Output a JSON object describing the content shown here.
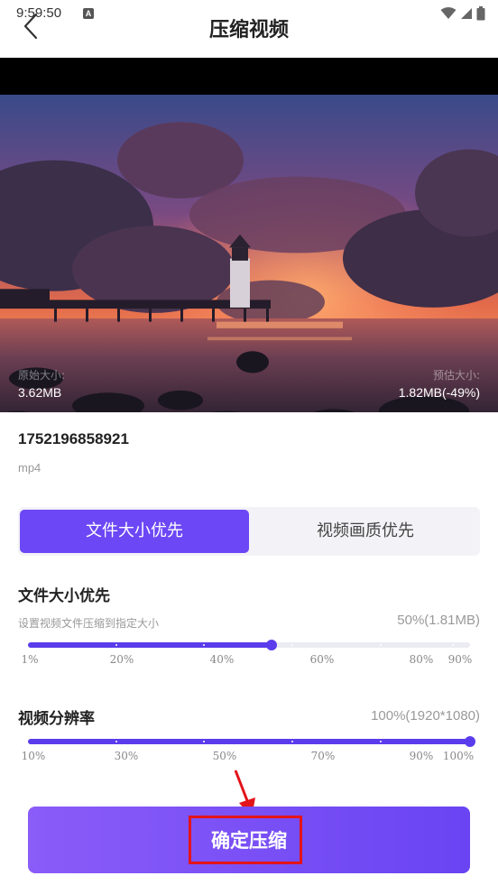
{
  "status_bar": {
    "time": "9:59:50",
    "indicator": "A",
    "icons": [
      "wifi-icon",
      "signal-icon",
      "battery-icon"
    ]
  },
  "nav": {
    "title": "压缩视频",
    "back_icon": "chevron-left-icon"
  },
  "video": {
    "original_size_label": "原始大小:",
    "original_size": "3.62MB",
    "estimated_size_label": "预估大小:",
    "estimated_size": "1.82MB(-49%)"
  },
  "file": {
    "name": "1752196858921",
    "format": "mp4"
  },
  "mode_tabs": {
    "active": "文件大小优先",
    "inactive": "视频画质优先"
  },
  "size_section": {
    "title": "文件大小优先",
    "description": "设置视频文件压缩到指定大小",
    "value": "50%(1.81MB)",
    "level": 0.55,
    "ticks": [
      "1%",
      "20%",
      "40%",
      "60%",
      "80%",
      "90%"
    ]
  },
  "resolution_section": {
    "title": "视频分辨率",
    "value": "100%(1920*1080)",
    "level": 1.0,
    "ticks": [
      "10%",
      "30%",
      "50%",
      "70%",
      "90%",
      "100%"
    ]
  },
  "confirm": {
    "label": "确定压缩"
  },
  "colors": {
    "accent": "#6c47f5",
    "highlight": "#e3141a"
  }
}
